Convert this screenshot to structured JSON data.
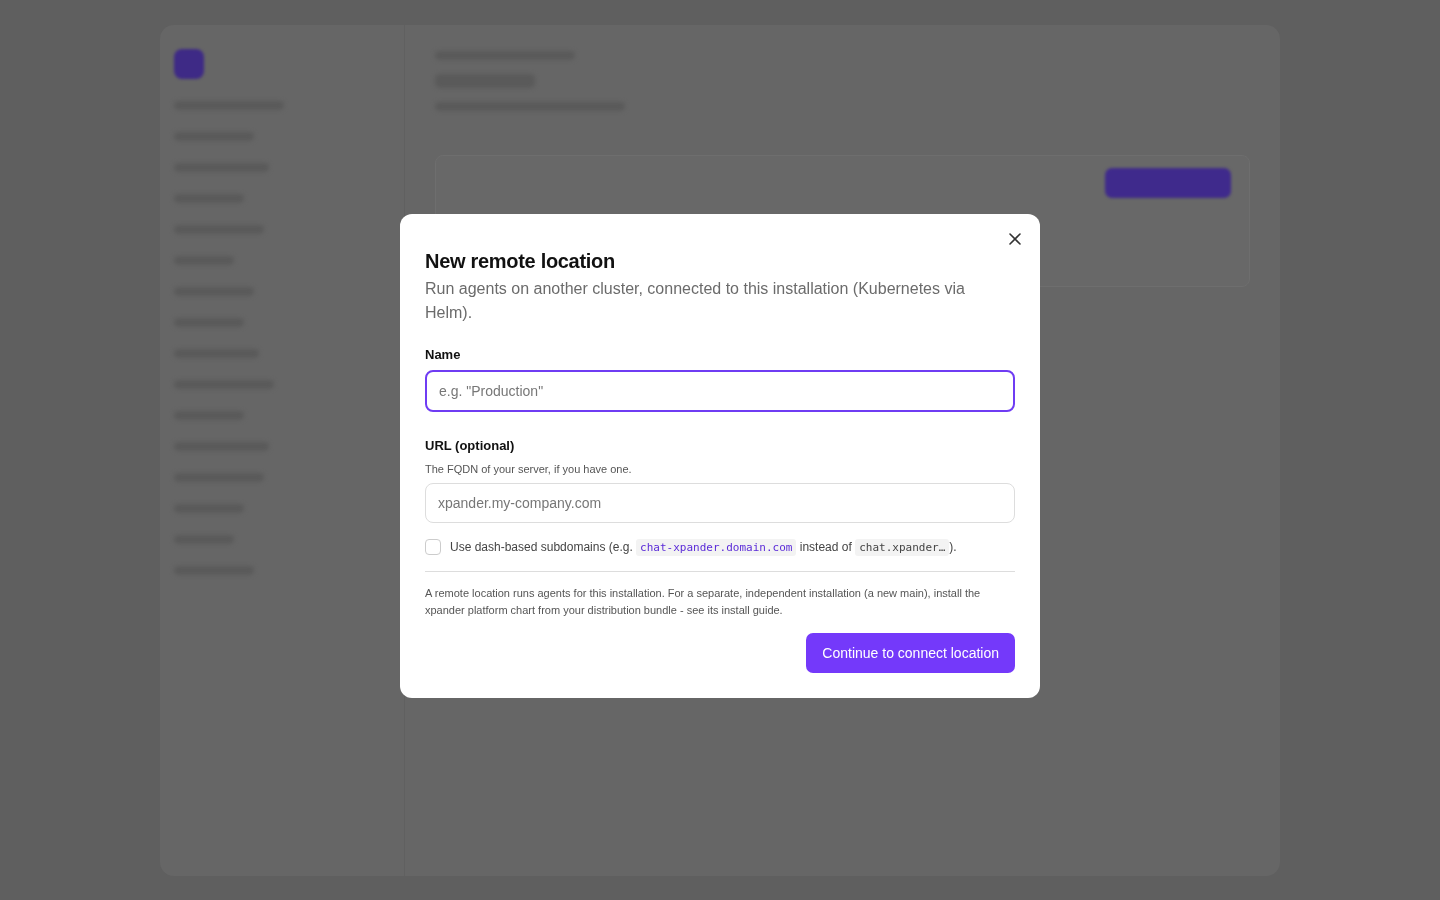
{
  "dialog": {
    "title": "New remote location",
    "description": "Run agents on another cluster, connected to this installation (Kubernetes via Helm).",
    "fields": [
      {
        "label": "Name",
        "placeholder": "e.g. \"Production\"",
        "focused": true
      },
      {
        "label": "URL (optional)",
        "hint": "The FQDN of your server, if you have one.",
        "placeholder": "xpander.my-company.com",
        "focused": false
      }
    ],
    "option": {
      "checked": false,
      "parts": [
        {
          "kind": "text",
          "text": "Use dash-based subdomains (e.g. "
        },
        {
          "kind": "code_accent",
          "text": "chat-xpander.domain.com"
        },
        {
          "kind": "text",
          "text": " instead of "
        },
        {
          "kind": "code",
          "text": "chat.xpander…"
        },
        {
          "kind": "text",
          "text": ")."
        }
      ]
    },
    "note": "A remote location runs agents for this installation. For a separate, independent installation (a new main), install the xpander platform chart from your distribution bundle - see its install guide.",
    "primary_button": "Continue to connect location"
  }
}
